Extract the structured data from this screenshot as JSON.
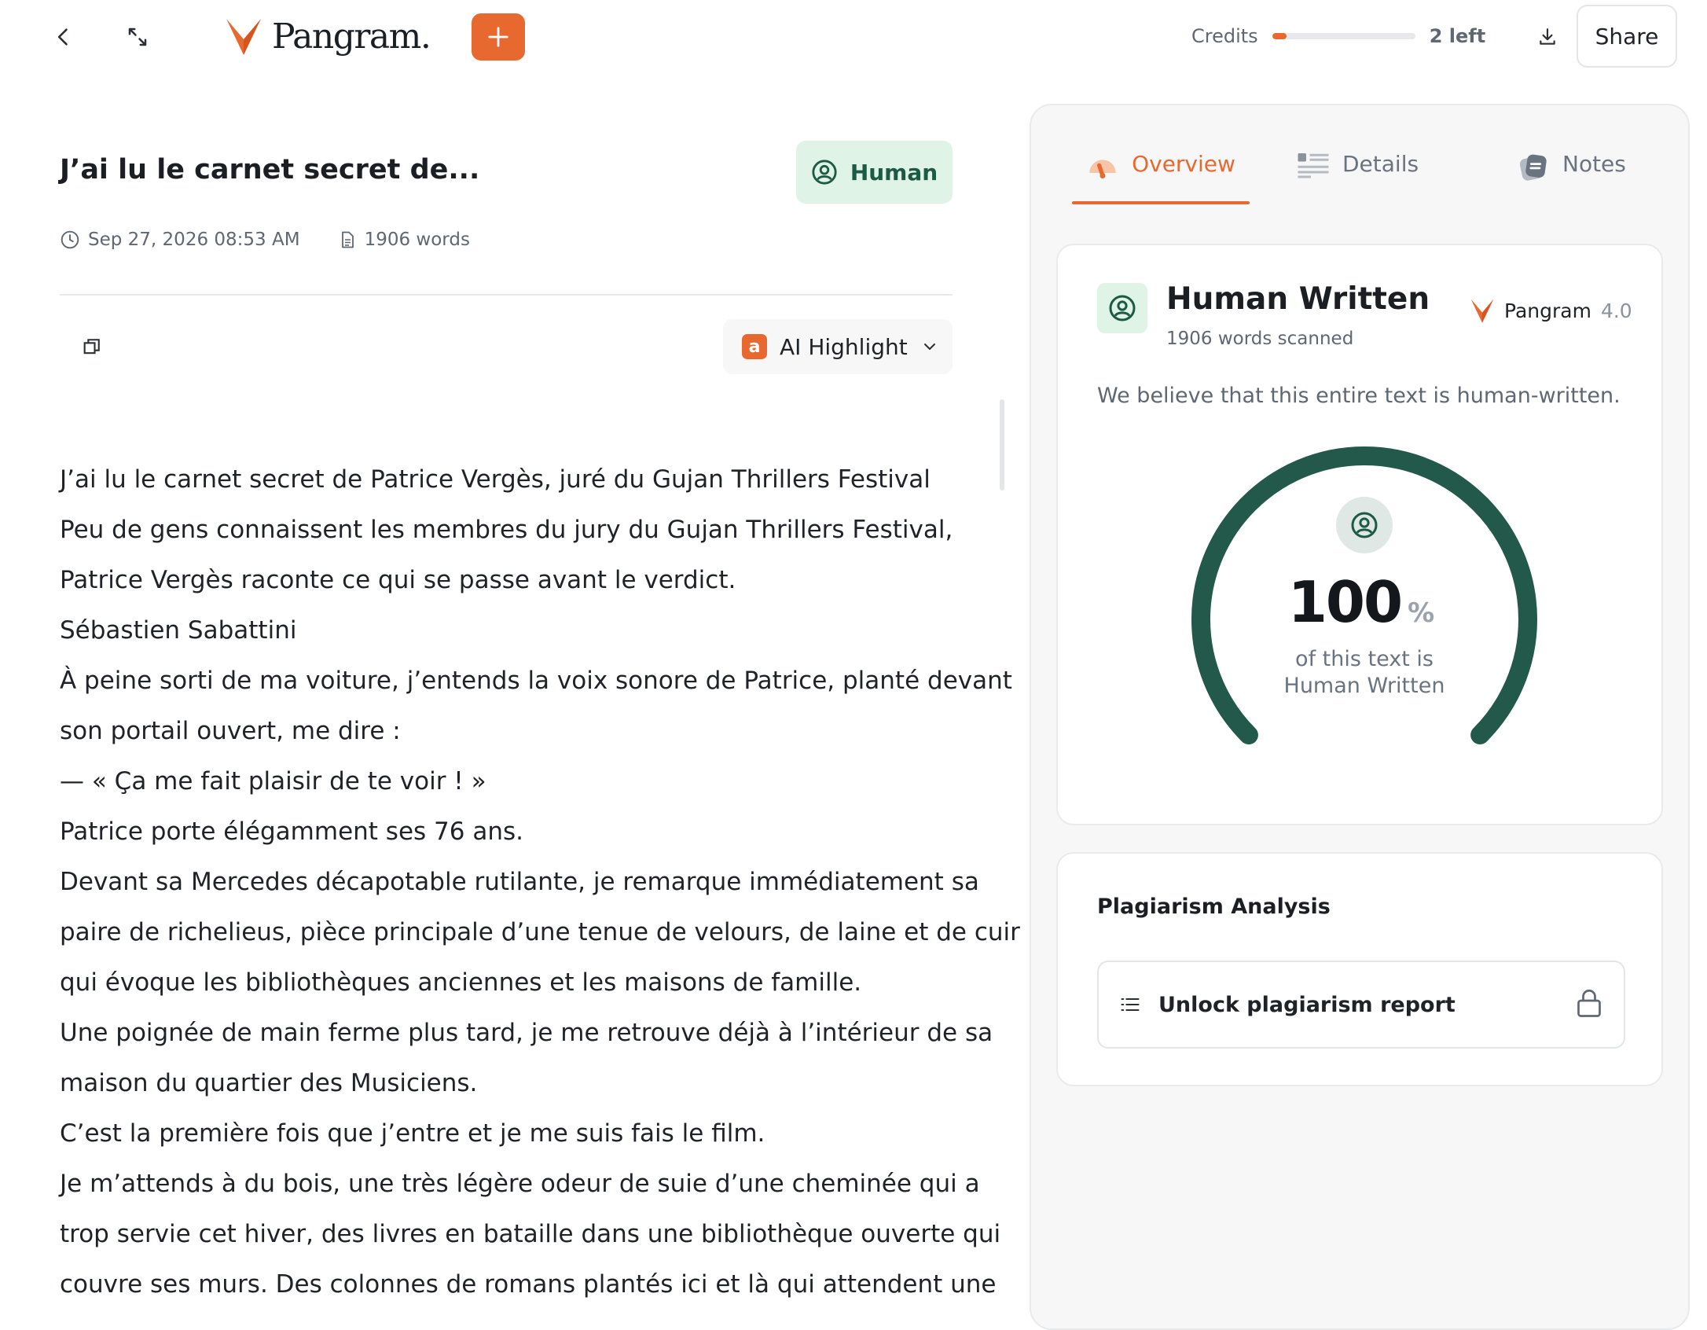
{
  "header": {
    "logo_text": "Pangram.",
    "credits_label": "Credits",
    "credits_fraction": 0.1,
    "credits_left": "2 left",
    "share_label": "Share",
    "accent_color": "#e8692f"
  },
  "document": {
    "title": "J’ai lu le carnet secret de...",
    "badge_label": "Human",
    "date": "Sep 27, 2026 08:53 AM",
    "word_count": "1906 words",
    "highlight_badge": "a",
    "highlight_label": "AI Highlight",
    "lines": [
      "J’ai lu le carnet secret de Patrice Vergès, juré du Gujan Thrillers Festival",
      "Peu de gens connaissent les membres du jury du Gujan Thrillers Festival,",
      "Patrice Vergès raconte ce qui se passe avant le verdict.",
      "Sébastien Sabattini",
      "À peine sorti de ma voiture, j’entends la voix sonore de Patrice, planté devant",
      "son portail ouvert, me dire :",
      "— « Ça me fait plaisir de te voir ! »",
      "Patrice porte élégamment ses 76 ans.",
      "Devant sa Mercedes décapotable rutilante, je remarque immédiatement sa",
      "paire de richelieus, pièce principale d’une tenue de velours, de laine et de cuir",
      "qui évoque les bibliothèques anciennes et les maisons de famille.",
      "Une poignée de main ferme plus tard, je me retrouve déjà à l’intérieur de sa",
      "maison du quartier des Musiciens.",
      "C’est la première fois que j’entre et je me suis fais le film.",
      "Je m’attends à du bois, une très légère odeur de suie d’une cheminée qui a",
      "trop servie cet hiver, des livres en bataille dans une bibliothèque ouverte qui",
      "couvre ses murs. Des colonnes de romans plantés ici et là qui attendent une"
    ]
  },
  "tabs": [
    {
      "label": "Overview",
      "active": true
    },
    {
      "label": "Details",
      "active": false
    },
    {
      "label": "Notes",
      "active": false
    }
  ],
  "result": {
    "title": "Human Written",
    "words_scanned": "1906 words scanned",
    "brand": "Pangram",
    "version": "4.0",
    "description": "We believe that this entire text is human-written.",
    "percent": 100,
    "percent_text": "100",
    "percent_symbol": "%",
    "caption_line1": "of this text is",
    "caption_line2": "Human Written",
    "gauge_color": "#22594a"
  },
  "plagiarism": {
    "title": "Plagiarism Analysis",
    "unlock_label": "Unlock plagiarism report"
  }
}
